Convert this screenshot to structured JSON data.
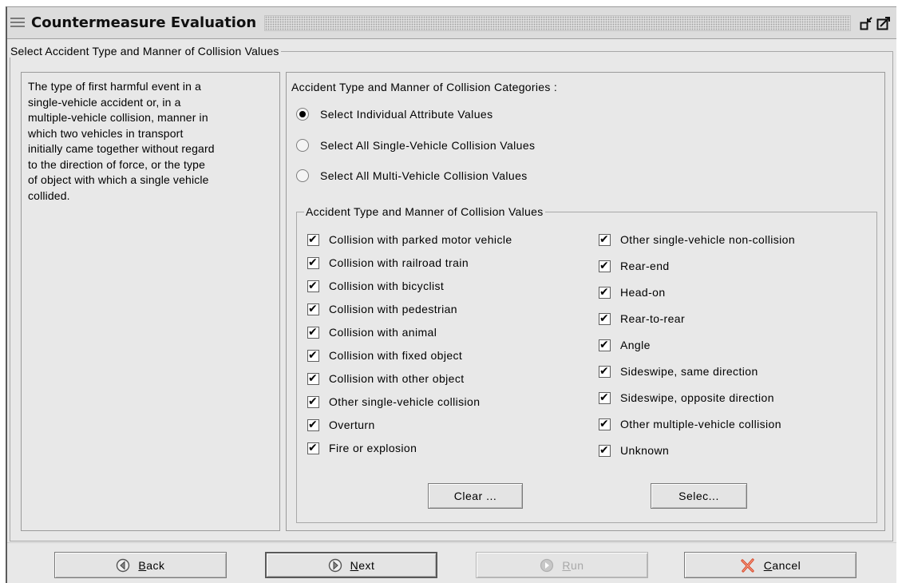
{
  "window": {
    "title": "Countermeasure Evaluation"
  },
  "section": {
    "legend": "Select Accident Type and Manner of Collision Values"
  },
  "description": {
    "lines": [
      "The type of first harmful event in a",
      "single-vehicle accident or, in a",
      "multiple-vehicle collision, manner in",
      "which two vehicles in transport",
      "initially came together without regard",
      "to the direction of force, or the type",
      "of object with which a single vehicle",
      "collided."
    ]
  },
  "categories": {
    "label": "Accident Type and Manner of Collision Categories :",
    "options": [
      {
        "label": "Select Individual Attribute Values",
        "selected": true
      },
      {
        "label": "Select All Single-Vehicle Collision Values",
        "selected": false
      },
      {
        "label": "Select All Multi-Vehicle Collision Values",
        "selected": false
      }
    ]
  },
  "values": {
    "legend": "Accident Type and Manner of Collision Values",
    "left": [
      {
        "label": "Collision with parked motor vehicle",
        "checked": true
      },
      {
        "label": "Collision with railroad train",
        "checked": true
      },
      {
        "label": "Collision with bicyclist",
        "checked": true
      },
      {
        "label": "Collision with pedestrian",
        "checked": true
      },
      {
        "label": "Collision with animal",
        "checked": true
      },
      {
        "label": "Collision with fixed object",
        "checked": true
      },
      {
        "label": "Collision with other object",
        "checked": true
      },
      {
        "label": "Other single-vehicle collision",
        "checked": true
      },
      {
        "label": "Overturn",
        "checked": true
      },
      {
        "label": "Fire or explosion",
        "checked": true
      }
    ],
    "right": [
      {
        "label": "Other single-vehicle non-collision",
        "checked": true
      },
      {
        "label": "Rear-end",
        "checked": true
      },
      {
        "label": "Head-on",
        "checked": true
      },
      {
        "label": "Rear-to-rear",
        "checked": true
      },
      {
        "label": "Angle",
        "checked": true
      },
      {
        "label": "Sideswipe, same direction",
        "checked": true
      },
      {
        "label": "Sideswipe, opposite direction",
        "checked": true
      },
      {
        "label": "Other multiple-vehicle collision",
        "checked": true
      },
      {
        "label": "Unknown",
        "checked": true
      }
    ],
    "clear_button": "Clear ...",
    "select_button": "Selec..."
  },
  "nav": {
    "back": "Back",
    "next": "Next",
    "run": "Run",
    "cancel": "Cancel"
  },
  "icons": {
    "back": "circle-left-arrow-icon",
    "next": "circle-right-arrow-icon",
    "run": "circle-play-icon",
    "cancel": "x-cross-icon"
  },
  "colors": {
    "window_bg": "#e8e8e8",
    "cancel_icon": "#d84a2a"
  }
}
